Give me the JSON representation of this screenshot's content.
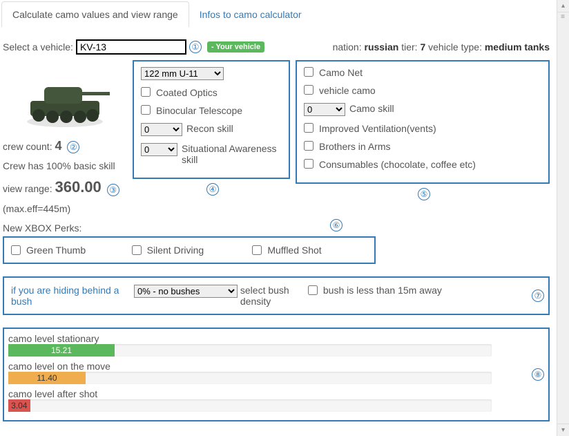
{
  "tabs": {
    "active": "Calculate camo values and view range",
    "inactive": "Infos to camo calculator"
  },
  "vehicle_select": {
    "label": "Select a vehicle:",
    "value": "KV-13",
    "badge": "- Your vehicle"
  },
  "meta": {
    "nation_label": "nation:",
    "nation": "russian",
    "tier_label": "tier:",
    "tier": "7",
    "type_label": "vehicle type:",
    "type": "medium tanks"
  },
  "left": {
    "crew_label": "crew count:",
    "crew_count": "4",
    "crew_skill": "Crew has 100% basic skill",
    "vr_label": "view range:",
    "vr_value": "360.00",
    "vr_sub": "(max.eff=445m)"
  },
  "mid": {
    "gun_selected": "122 mm U-11",
    "coated": "Coated Optics",
    "binoc": "Binocular Telescope",
    "recon_val": "0",
    "recon_label": "Recon skill",
    "sa_val": "0",
    "sa_label": "Situational Awareness skill"
  },
  "right": {
    "camo_net": "Camo Net",
    "vehicle_camo": "vehicle camo",
    "camo_skill_val": "0",
    "camo_skill_label": "Camo skill",
    "vents": "Improved Ventilation(vents)",
    "bia": "Brothers in Arms",
    "consumables": "Consumables (chocolate, coffee etc)"
  },
  "perks": {
    "header": "New XBOX Perks:",
    "green_thumb": "Green Thumb",
    "silent_driving": "Silent Driving",
    "muffled_shot": "Muffled Shot"
  },
  "bush": {
    "link": "if you are hiding behind a bush",
    "select_value": "0% - no bushes",
    "select_label": "select bush density",
    "close": "bush is less than 15m away"
  },
  "results": {
    "stationary_label": "camo level stationary",
    "stationary_val": "15.21",
    "move_label": "camo level on the move",
    "move_val": "11.40",
    "shot_label": "camo level after shot",
    "shot_val": "3.04"
  },
  "markers": {
    "m1": "①",
    "m2": "②",
    "m3": "③",
    "m4": "④",
    "m5": "⑤",
    "m6": "⑥",
    "m7": "⑦",
    "m8": "⑧"
  }
}
